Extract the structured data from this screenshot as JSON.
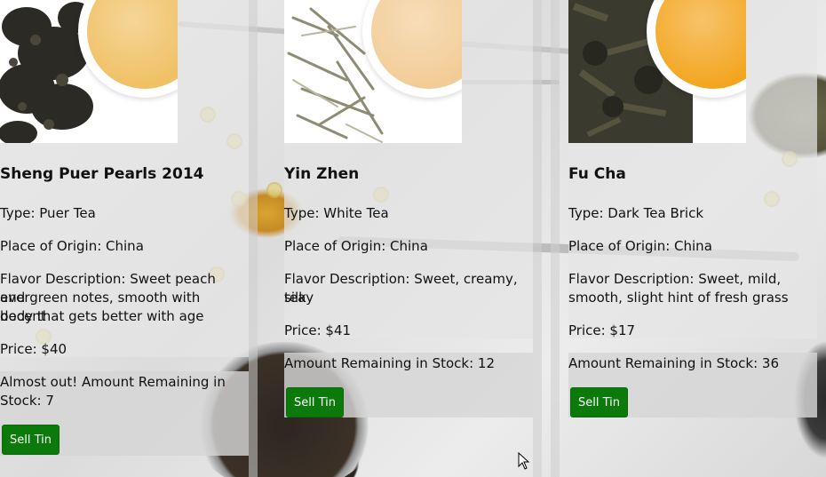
{
  "products": [
    {
      "name": "Sheng Puer Pearls 2014",
      "type": "Type: Puer Tea",
      "origin": "Place of Origin: China",
      "flavor_line1": "Flavor Description: Sweet peach and",
      "flavor_line2": "evergreen notes, smooth with decent",
      "flavor_line3": "body that gets better with age",
      "price": "Price: $40",
      "stock_line1": "Almost out! Amount Remaining in",
      "stock_line2": "Stock: 7",
      "button_label": "Sell Tin",
      "liquid_color": "#f0c064"
    },
    {
      "name": "Yin Zhen",
      "type": "Type: White Tea",
      "origin": "Place of Origin: China",
      "flavor_line1": "Flavor Description: Sweet, creamy, silky",
      "flavor_line2": "tea",
      "price": "Price: $41",
      "stock_line1": "Amount Remaining in Stock: 12",
      "button_label": "Sell Tin",
      "liquid_color": "#f2cc96"
    },
    {
      "name": "Fu Cha",
      "type": "Type: Dark Tea Brick",
      "origin": "Place of Origin: China",
      "flavor_line1": "Flavor Description: Sweet, mild,",
      "flavor_line2": "smooth, slight hint of fresh grass",
      "price": "Price: $17",
      "stock_line1": "Amount Remaining in Stock: 36",
      "button_label": "Sell Tin",
      "liquid_color": "#f3a51f"
    }
  ],
  "colors": {
    "button_bg": "#0b7a0b",
    "card_bg": "#e4e4e4"
  }
}
